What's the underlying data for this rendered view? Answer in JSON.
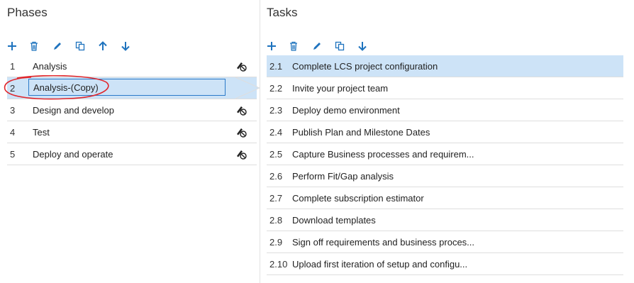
{
  "phases": {
    "title": "Phases",
    "toolbar": [
      {
        "action": "add",
        "icon": "plus-icon"
      },
      {
        "action": "delete",
        "icon": "trash-icon"
      },
      {
        "action": "edit",
        "icon": "pencil-icon"
      },
      {
        "action": "copy",
        "icon": "copy-icon"
      },
      {
        "action": "move-up",
        "icon": "arrow-up-icon"
      },
      {
        "action": "move-down",
        "icon": "arrow-down-icon"
      }
    ],
    "items": [
      {
        "num": "1",
        "name": "Analysis",
        "locked": true
      },
      {
        "num": "2",
        "name": "",
        "edit_value": "Analysis-(Copy)",
        "locked": false
      },
      {
        "num": "3",
        "name": "Design and develop",
        "locked": true
      },
      {
        "num": "4",
        "name": "Test",
        "locked": true
      },
      {
        "num": "5",
        "name": "Deploy and operate",
        "locked": true
      }
    ]
  },
  "tasks": {
    "title": "Tasks",
    "toolbar": [
      {
        "action": "add",
        "icon": "plus-icon"
      },
      {
        "action": "delete",
        "icon": "trash-icon"
      },
      {
        "action": "edit",
        "icon": "pencil-icon"
      },
      {
        "action": "copy",
        "icon": "copy-icon"
      },
      {
        "action": "move-down",
        "icon": "arrow-down-icon"
      }
    ],
    "items": [
      {
        "num": "2.1",
        "name": "Complete LCS project configuration"
      },
      {
        "num": "2.2",
        "name": "Invite your project team"
      },
      {
        "num": "2.3",
        "name": "Deploy demo environment"
      },
      {
        "num": "2.4",
        "name": "Publish Plan and Milestone Dates"
      },
      {
        "num": "2.5",
        "name": "Capture Business processes and requirem..."
      },
      {
        "num": "2.6",
        "name": "Perform Fit/Gap analysis"
      },
      {
        "num": "2.7",
        "name": "Complete subscription estimator"
      },
      {
        "num": "2.8",
        "name": "Download templates"
      },
      {
        "num": "2.9",
        "name": "Sign off requirements and business proces..."
      },
      {
        "num": "2.10",
        "name": "Upload first iteration of setup and configu..."
      }
    ]
  },
  "colors": {
    "accent": "#1e73be",
    "selection": "#cde3f7",
    "annotation": "#e0262b"
  }
}
